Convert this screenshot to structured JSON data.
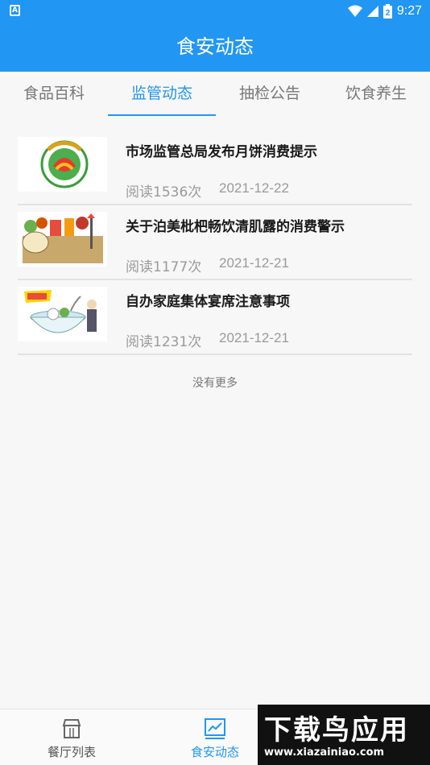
{
  "status_bar": {
    "time": "9:27",
    "battery_level": "2",
    "a_label": "A"
  },
  "app_bar": {
    "title": "食安动态"
  },
  "tabs": [
    {
      "label": "食品百科",
      "active": false
    },
    {
      "label": "监管动态",
      "active": true
    },
    {
      "label": "抽检公告",
      "active": false
    },
    {
      "label": "饮食养生",
      "active": false
    }
  ],
  "news": [
    {
      "title": "市场监管总局发布月饼消费提示",
      "reads": "阅读1536次",
      "date": "2021-12-22",
      "thumb": "food-safety-logo"
    },
    {
      "title": "关于泊美枇杷畅饮清肌露的消费警示",
      "reads": "阅读1177次",
      "date": "2021-12-21",
      "thumb": "food-safety-cartoon"
    },
    {
      "title": "自办家庭集体宴席注意事项",
      "reads": "阅读1231次",
      "date": "2021-12-21",
      "thumb": "banquet-cartoon"
    }
  ],
  "no_more": "没有更多",
  "bottom_nav": [
    {
      "label": "餐厅列表",
      "icon": "restaurant-icon",
      "active": false
    },
    {
      "label": "食安动态",
      "icon": "chart-icon",
      "active": true
    }
  ],
  "watermark": {
    "big": "下载鸟应用",
    "small": "www.xiazainiao.com"
  },
  "colors": {
    "primary": "#2196f3",
    "text": "#1a1a1a",
    "muted": "#9a9a9a"
  }
}
